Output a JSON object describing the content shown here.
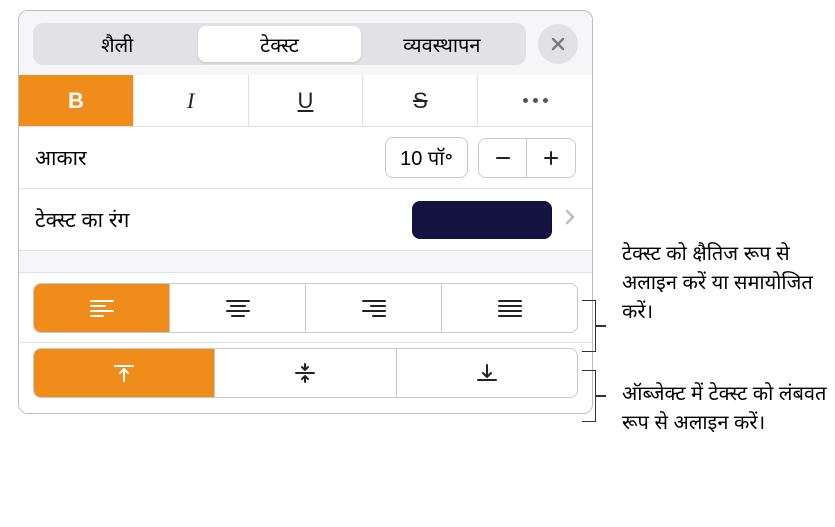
{
  "tabs": {
    "style": "शैली",
    "text": "टेक्स्ट",
    "arrange": "व्यवस्थापन"
  },
  "styles": {
    "bold": "B",
    "italic": "I",
    "underline": "U",
    "strike": "S"
  },
  "size": {
    "label": "आकार",
    "value": "10 पॉ॰"
  },
  "textcolor": {
    "label": "टेक्स्ट का रंग",
    "value": "#141241"
  },
  "callouts": {
    "horizontal": "टेक्स्ट को क्षैतिज रूप से अलाइन करें या समायोजित करें।",
    "vertical": "ऑब्जेक्ट में टेक्स्ट को लंबवत रूप से अलाइन करें।"
  }
}
